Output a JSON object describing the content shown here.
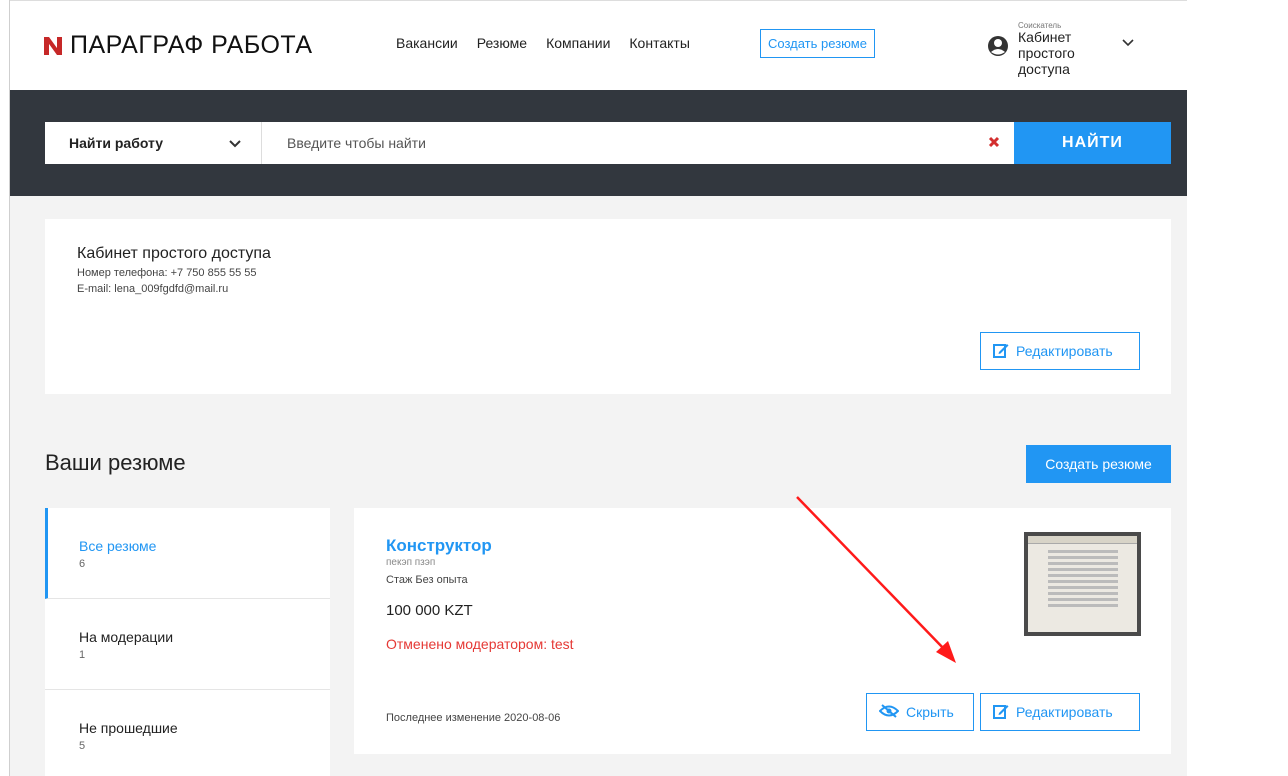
{
  "header": {
    "logo_text": "ПАРАГРАФ РАБОТА",
    "nav": [
      "Вакансии",
      "Резюме",
      "Компании",
      "Контакты"
    ],
    "create_resume": "Создать резюме",
    "account_role": "Соискатель",
    "account_name": "Кабинет простого доступа"
  },
  "search": {
    "select_value": "Найти работу",
    "placeholder": "Введите чтобы найти",
    "button": "НАЙТИ"
  },
  "profile": {
    "name": "Кабинет простого доступа",
    "phone": "Номер телефона: +7 750 855 55 55",
    "email": "E-mail: lena_009fgdfd@mail.ru",
    "edit_label": "Редактировать"
  },
  "resumes": {
    "title": "Ваши резюме",
    "create_label": "Создать резюме",
    "sidebar": [
      {
        "label": "Все резюме",
        "count": "6"
      },
      {
        "label": "На модерации",
        "count": "1"
      },
      {
        "label": "Не прошедшие",
        "count": "5"
      }
    ],
    "card": {
      "title": "Конструктор",
      "subtitle": "пекэп пзэп",
      "experience": "Стаж Без опыта",
      "salary": "100 000  KZT",
      "status": "Отменено модератором: test",
      "updated": "Последнее изменение 2020-08-06",
      "hide_label": "Скрыть",
      "edit_label": "Редактировать"
    }
  },
  "colors": {
    "accent": "#2196f3",
    "dark_band": "#32373e",
    "status_red": "#e53935",
    "annotation_arrow": "#ff1a1a"
  }
}
